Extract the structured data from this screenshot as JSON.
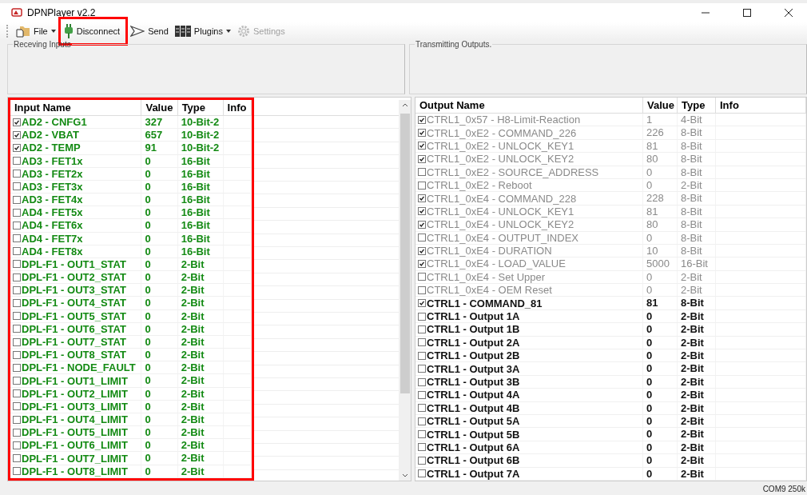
{
  "window": {
    "title": "DPNPlayer v2.2"
  },
  "toolbar": [
    {
      "kind": "file",
      "label": "File",
      "dropdown": true,
      "disabled": false,
      "highlighted": false
    },
    {
      "kind": "connect",
      "label": "Disconnect",
      "dropdown": false,
      "disabled": false,
      "highlighted": true
    },
    {
      "kind": "send",
      "label": "Send",
      "dropdown": false,
      "disabled": false,
      "highlighted": false
    },
    {
      "kind": "plugins",
      "label": "Plugins",
      "dropdown": true,
      "disabled": false,
      "highlighted": false
    },
    {
      "kind": "settings",
      "label": "Settings",
      "dropdown": false,
      "disabled": true,
      "highlighted": false
    }
  ],
  "groups": [
    {
      "title": "Receving Inputs"
    },
    {
      "title": "Transmitting Outputs."
    }
  ],
  "inputs": {
    "highlighted": true,
    "columns": [
      "Input Name",
      "Value",
      "Type",
      "Info"
    ],
    "rows": [
      {
        "name": "AD2 - CNFG1",
        "value": "327",
        "type": "10-Bit-2",
        "checked": true
      },
      {
        "name": "AD2 - VBAT",
        "value": "657",
        "type": "10-Bit-2",
        "checked": true
      },
      {
        "name": "AD2 - TEMP",
        "value": "91",
        "type": "10-Bit-2",
        "checked": true
      },
      {
        "name": "AD3 - FET1x",
        "value": "0",
        "type": "16-Bit",
        "checked": false
      },
      {
        "name": "AD3 - FET2x",
        "value": "0",
        "type": "16-Bit",
        "checked": false
      },
      {
        "name": "AD3 - FET3x",
        "value": "0",
        "type": "16-Bit",
        "checked": false
      },
      {
        "name": "AD3 - FET4x",
        "value": "0",
        "type": "16-Bit",
        "checked": false
      },
      {
        "name": "AD4 - FET5x",
        "value": "0",
        "type": "16-Bit",
        "checked": false
      },
      {
        "name": "AD4 - FET6x",
        "value": "0",
        "type": "16-Bit",
        "checked": false
      },
      {
        "name": "AD4 - FET7x",
        "value": "0",
        "type": "16-Bit",
        "checked": false
      },
      {
        "name": "AD4 - FET8x",
        "value": "0",
        "type": "16-Bit",
        "checked": false
      },
      {
        "name": "DPL-F1 - OUT1_STAT",
        "value": "0",
        "type": "2-Bit",
        "checked": false
      },
      {
        "name": "DPL-F1 - OUT2_STAT",
        "value": "0",
        "type": "2-Bit",
        "checked": false
      },
      {
        "name": "DPL-F1 - OUT3_STAT",
        "value": "0",
        "type": "2-Bit",
        "checked": false
      },
      {
        "name": "DPL-F1 - OUT4_STAT",
        "value": "0",
        "type": "2-Bit",
        "checked": false
      },
      {
        "name": "DPL-F1 - OUT5_STAT",
        "value": "0",
        "type": "2-Bit",
        "checked": false
      },
      {
        "name": "DPL-F1 - OUT6_STAT",
        "value": "0",
        "type": "2-Bit",
        "checked": false
      },
      {
        "name": "DPL-F1 - OUT7_STAT",
        "value": "0",
        "type": "2-Bit",
        "checked": false
      },
      {
        "name": "DPL-F1 - OUT8_STAT",
        "value": "0",
        "type": "2-Bit",
        "checked": false
      },
      {
        "name": "DPL-F1 - NODE_FAULT",
        "value": "0",
        "type": "2-Bit",
        "checked": false
      },
      {
        "name": "DPL-F1 - OUT1_LIMIT",
        "value": "0",
        "type": "2-Bit",
        "checked": false
      },
      {
        "name": "DPL-F1 - OUT2_LIMIT",
        "value": "0",
        "type": "2-Bit",
        "checked": false
      },
      {
        "name": "DPL-F1 - OUT3_LIMIT",
        "value": "0",
        "type": "2-Bit",
        "checked": false
      },
      {
        "name": "DPL-F1 - OUT4_LIMIT",
        "value": "0",
        "type": "2-Bit",
        "checked": false
      },
      {
        "name": "DPL-F1 - OUT5_LIMIT",
        "value": "0",
        "type": "2-Bit",
        "checked": false
      },
      {
        "name": "DPL-F1 - OUT6_LIMIT",
        "value": "0",
        "type": "2-Bit",
        "checked": false
      },
      {
        "name": "DPL-F1 - OUT7_LIMIT",
        "value": "0",
        "type": "2-Bit",
        "checked": false
      },
      {
        "name": "DPL-F1 - OUT8_LIMIT",
        "value": "0",
        "type": "2-Bit",
        "checked": false
      }
    ]
  },
  "outputs": {
    "columns": [
      "Output Name",
      "Value",
      "Type",
      "Info"
    ],
    "rows": [
      {
        "name": "CTRL1_0x57 - H8-Limit-Reaction",
        "value": "1",
        "type": "4-Bit",
        "checked": true,
        "disabled": true
      },
      {
        "name": "CTRL1_0xE2 - COMMAND_226",
        "value": "226",
        "type": "8-Bit",
        "checked": true,
        "disabled": true
      },
      {
        "name": "CTRL1_0xE2 - UNLOCK_KEY1",
        "value": "81",
        "type": "8-Bit",
        "checked": true,
        "disabled": true
      },
      {
        "name": "CTRL1_0xE2 - UNLOCK_KEY2",
        "value": "80",
        "type": "8-Bit",
        "checked": true,
        "disabled": true
      },
      {
        "name": "CTRL1_0xE2 - SOURCE_ADDRESS",
        "value": "0",
        "type": "8-Bit",
        "checked": false,
        "disabled": true
      },
      {
        "name": "CTRL1_0xE2 - Reboot",
        "value": "0",
        "type": "2-Bit",
        "checked": false,
        "disabled": true
      },
      {
        "name": "CTRL1_0xE4 - COMMAND_228",
        "value": "228",
        "type": "8-Bit",
        "checked": true,
        "disabled": true
      },
      {
        "name": "CTRL1_0xE4 - UNLOCK_KEY1",
        "value": "81",
        "type": "8-Bit",
        "checked": true,
        "disabled": true
      },
      {
        "name": "CTRL1_0xE4 - UNLOCK_KEY2",
        "value": "80",
        "type": "8-Bit",
        "checked": true,
        "disabled": true
      },
      {
        "name": "CTRL1_0xE4 - OUTPUT_INDEX",
        "value": "0",
        "type": "8-Bit",
        "checked": false,
        "disabled": true
      },
      {
        "name": "CTRL1_0xE4 - DURATION",
        "value": "10",
        "type": "8-Bit",
        "checked": true,
        "disabled": true
      },
      {
        "name": "CTRL1_0xE4 - LOAD_VALUE",
        "value": "5000",
        "type": "16-Bit",
        "checked": true,
        "disabled": true
      },
      {
        "name": "CTRL1_0xE4 - Set Upper",
        "value": "0",
        "type": "2-Bit",
        "checked": false,
        "disabled": true
      },
      {
        "name": "CTRL1_0xE4 - OEM Reset",
        "value": "0",
        "type": "2-Bit",
        "checked": false,
        "disabled": true
      },
      {
        "name": "CTRL1 - COMMAND_81",
        "value": "81",
        "type": "8-Bit",
        "checked": true,
        "disabled": false
      },
      {
        "name": "CTRL1 - Output 1A",
        "value": "0",
        "type": "2-Bit",
        "checked": false,
        "disabled": false
      },
      {
        "name": "CTRL1 - Output 1B",
        "value": "0",
        "type": "2-Bit",
        "checked": false,
        "disabled": false
      },
      {
        "name": "CTRL1 - Output 2A",
        "value": "0",
        "type": "2-Bit",
        "checked": false,
        "disabled": false
      },
      {
        "name": "CTRL1 - Output 2B",
        "value": "0",
        "type": "2-Bit",
        "checked": false,
        "disabled": false
      },
      {
        "name": "CTRL1 - Output 3A",
        "value": "0",
        "type": "2-Bit",
        "checked": false,
        "disabled": false
      },
      {
        "name": "CTRL1 - Output 3B",
        "value": "0",
        "type": "2-Bit",
        "checked": false,
        "disabled": false
      },
      {
        "name": "CTRL1 - Output 4A",
        "value": "0",
        "type": "2-Bit",
        "checked": false,
        "disabled": false
      },
      {
        "name": "CTRL1 - Output 4B",
        "value": "0",
        "type": "2-Bit",
        "checked": false,
        "disabled": false
      },
      {
        "name": "CTRL1 - Output 5A",
        "value": "0",
        "type": "2-Bit",
        "checked": false,
        "disabled": false
      },
      {
        "name": "CTRL1 - Output 5B",
        "value": "0",
        "type": "2-Bit",
        "checked": false,
        "disabled": false
      },
      {
        "name": "CTRL1 - Output 6A",
        "value": "0",
        "type": "2-Bit",
        "checked": false,
        "disabled": false
      },
      {
        "name": "CTRL1 - Output 6B",
        "value": "0",
        "type": "2-Bit",
        "checked": false,
        "disabled": false
      },
      {
        "name": "CTRL1 - Output 7A",
        "value": "0",
        "type": "2-Bit",
        "checked": false,
        "disabled": false
      }
    ]
  },
  "status_bar": {
    "text": "COM9 250k"
  }
}
